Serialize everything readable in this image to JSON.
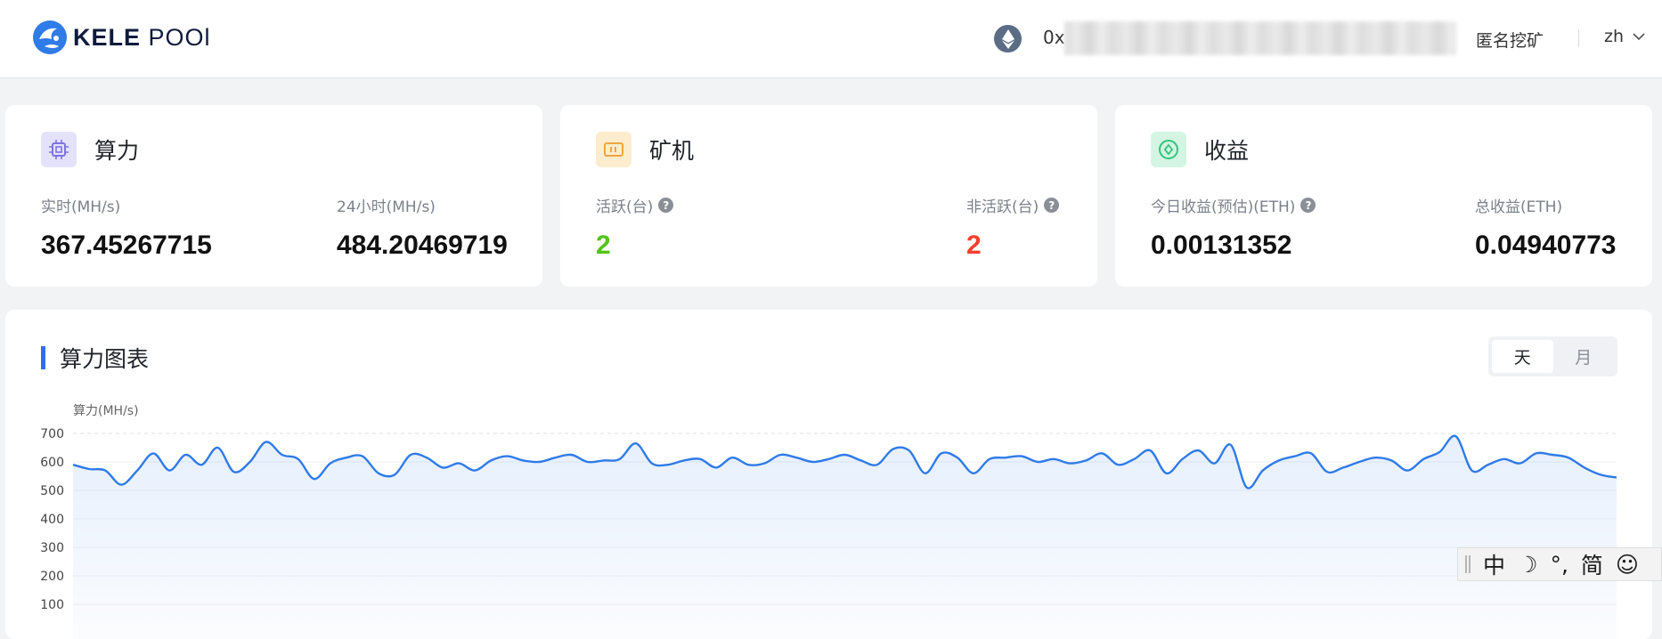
{
  "header": {
    "brand": "KELE",
    "brand_suffix": "POOl",
    "coin_icon": "ethereum-icon",
    "wallet_prefix": "0x",
    "anonymous_mining": "匿名挖矿",
    "language": "zh"
  },
  "cards": {
    "hashrate": {
      "title": "算力",
      "icon": "chip-icon",
      "realtime_label": "实时(MH/s)",
      "realtime_value": "367.45267715",
      "day_label": "24小时(MH/s)",
      "day_value": "484.20469719"
    },
    "miners": {
      "title": "矿机",
      "icon": "miner-icon",
      "active_label": "活跃(台)",
      "active_value": "2",
      "inactive_label": "非活跃(台)",
      "inactive_value": "2"
    },
    "earnings": {
      "title": "收益",
      "icon": "coin-icon",
      "today_label": "今日收益(预估)(ETH)",
      "today_value": "0.00131352",
      "total_label": "总收益(ETH)",
      "total_value": "0.04940773"
    }
  },
  "chart": {
    "title": "算力图表",
    "range_day": "天",
    "range_month": "月",
    "active_range": "天"
  },
  "chart_data": {
    "type": "area",
    "ylabel": "算力(MH/s)",
    "xlabel": "",
    "ylim": [
      0,
      700
    ],
    "yticks": [
      "700",
      "600",
      "500",
      "400",
      "300",
      "200",
      "100"
    ],
    "grid": true,
    "series": [
      {
        "color": "#2f7be8",
        "values": [
          590,
          575,
          570,
          520,
          570,
          630,
          570,
          625,
          590,
          650,
          565,
          600,
          670,
          625,
          610,
          540,
          595,
          615,
          620,
          560,
          555,
          625,
          615,
          580,
          595,
          570,
          605,
          620,
          605,
          600,
          615,
          625,
          600,
          605,
          610,
          665,
          595,
          590,
          605,
          610,
          580,
          615,
          590,
          595,
          625,
          615,
          600,
          610,
          625,
          605,
          590,
          645,
          640,
          560,
          630,
          615,
          560,
          610,
          615,
          620,
          600,
          610,
          595,
          605,
          630,
          590,
          610,
          640,
          560,
          610,
          640,
          595,
          660,
          510,
          570,
          605,
          620,
          630,
          565,
          580,
          600,
          615,
          605,
          570,
          610,
          635,
          690,
          570,
          590,
          610,
          595,
          630,
          625,
          615,
          580,
          555,
          545
        ]
      }
    ]
  },
  "ime": {
    "mode": "中",
    "moon": "☽",
    "punct": "°,",
    "script": "简",
    "emoji": "☺"
  }
}
